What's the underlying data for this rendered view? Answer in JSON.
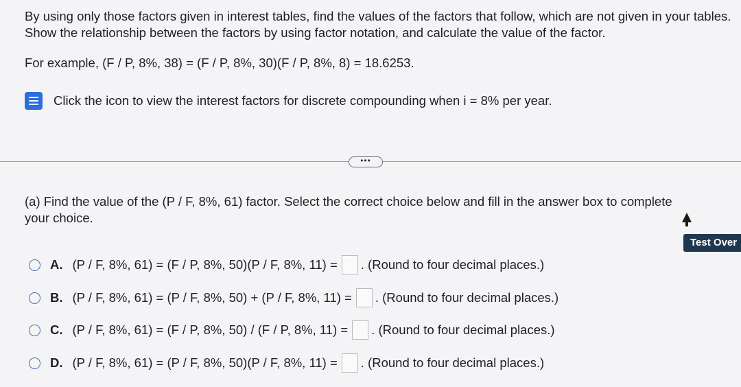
{
  "intro_text": "By using only those factors given in interest tables, find the values of the factors that follow, which are not given in your tables. Show the relationship between the factors by using factor notation, and calculate the value of the factor.",
  "example_text": "For example, (F / P, 8%, 38) = (F / P, 8%, 30)(F / P, 8%, 8) = 18.6253.",
  "hint": {
    "icon": "book-icon",
    "text": "Click the icon to view the interest factors for discrete compounding when i = 8% per year."
  },
  "more_button_label": "•••",
  "question_text": "(a) Find the value of the (P / F, 8%, 61) factor. Select the correct choice below and fill in the answer box to complete your choice.",
  "choices": [
    {
      "letter": "A.",
      "expression": "(P / F, 8%, 61) = (F / P, 8%, 50)(P / F, 8%, 11) =",
      "note": ". (Round to four decimal places.)"
    },
    {
      "letter": "B.",
      "expression": "(P / F, 8%, 61) = (P / F, 8%, 50) + (P / F, 8%, 11) =",
      "note": ". (Round to four decimal places.)"
    },
    {
      "letter": "C.",
      "expression": "(P / F, 8%, 61) = (F / P, 8%, 50) / (F / P, 8%, 11) =",
      "note": ". (Round to four decimal places.)"
    },
    {
      "letter": "D.",
      "expression": "(P / F, 8%, 61) = (P / F, 8%, 50)(P / F, 8%, 11) =",
      "note": ". (Round to four decimal places.)"
    }
  ],
  "test_overview_label": "Test Over",
  "colors": {
    "accent": "#2a6fdb",
    "test_button": "#20384f"
  }
}
